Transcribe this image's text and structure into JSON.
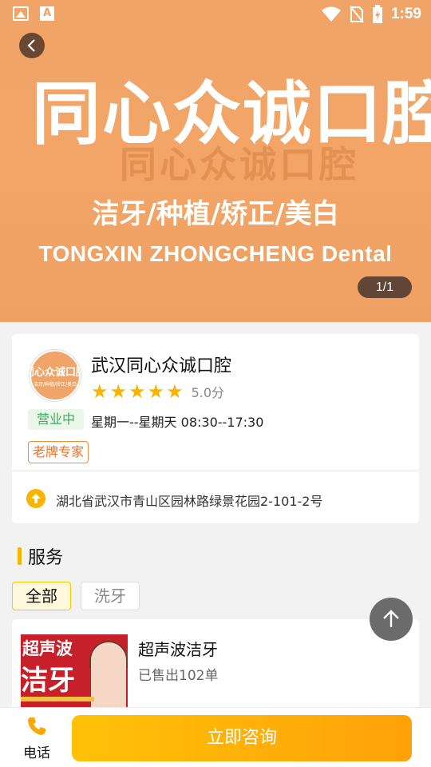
{
  "status_bar": {
    "time": "1:59"
  },
  "banner": {
    "title": "同心众诚口腔",
    "subtitle": "洁牙/种植/矫正/美白",
    "english": "TONGXIN ZHONGCHENG Dental",
    "background_sign": "同心众诚口腔",
    "page_indicator": "1/1"
  },
  "store": {
    "logo_text": "同心众诚口腔",
    "logo_subtext": "洁牙/种植/矫正/美白",
    "name": "武汉同心众诚口腔",
    "rating": 5,
    "score": "5.0分",
    "status": "营业中",
    "hours": "星期一--星期天 08:30--17:30",
    "tag": "老牌专家",
    "address": "湖北省武汉市青山区园林路绿景花园2-101-2号"
  },
  "services": {
    "title": "服务",
    "tabs": [
      {
        "label": "全部"
      },
      {
        "label": "洗牙"
      }
    ],
    "items": [
      {
        "name": "超声波洁牙",
        "sold": "已售出102单",
        "image_text_1": "超声波",
        "image_text_2": "洁牙"
      }
    ]
  },
  "bottom_bar": {
    "phone_label": "电话",
    "consult_label": "立即咨询"
  },
  "colors": {
    "accent": "#f8b400",
    "banner": "#f0a468",
    "open_status": "#3cae5c",
    "tag": "#f07020"
  }
}
